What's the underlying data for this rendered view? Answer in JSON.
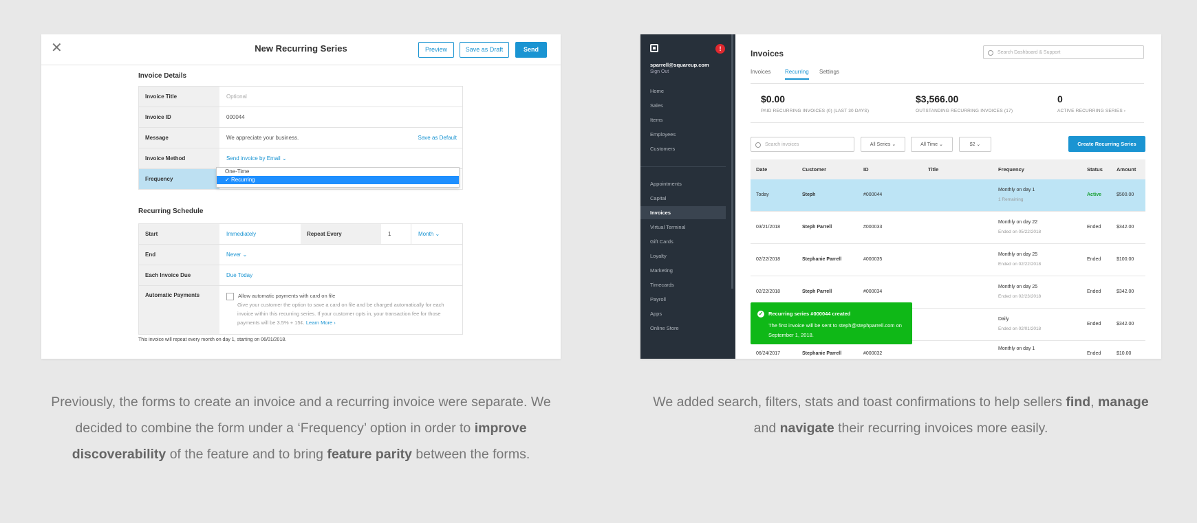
{
  "left": {
    "title": "New Recurring Series",
    "buttons": {
      "preview": "Preview",
      "save_draft": "Save as Draft",
      "send": "Send"
    },
    "invoice_details": {
      "heading": "Invoice Details",
      "invoice_title": {
        "label": "Invoice Title",
        "placeholder": "Optional"
      },
      "invoice_id": {
        "label": "Invoice ID",
        "value": "000044"
      },
      "message": {
        "label": "Message",
        "value": "We appreciate your business.",
        "action": "Save as Default"
      },
      "invoice_method": {
        "label": "Invoice Method",
        "value": "Send invoice by Email"
      },
      "frequency": {
        "label": "Frequency",
        "options": [
          "One-Time",
          "Recurring"
        ],
        "selected": "Recurring"
      }
    },
    "schedule": {
      "heading": "Recurring Schedule",
      "start": {
        "label": "Start",
        "value": "Immediately"
      },
      "repeat_every": {
        "label": "Repeat Every",
        "value": "1",
        "unit": "Month"
      },
      "end": {
        "label": "End",
        "value": "Never"
      },
      "due": {
        "label": "Each Invoice Due",
        "value": "Due Today"
      },
      "autopay": {
        "label": "Automatic Payments",
        "checkbox_label": "Allow automatic payments with card on file",
        "description": "Give your customer the option to save a card on file and be charged automatically for each invoice within this recurring series. If your customer opts in, your transaction fee for those payments will be 3.5% + 15¢.",
        "learn_more": "Learn More"
      }
    },
    "footnote": "This invoice will repeat every month on day 1, starting on 06/01/2018."
  },
  "right": {
    "sidebar": {
      "alert_count": "!",
      "user_email": "sparrell@squareup.com",
      "sign_out": "Sign Out",
      "items_top": [
        "Home",
        "Sales",
        "Items",
        "Employees",
        "Customers"
      ],
      "items_bottom": [
        "Appointments",
        "Capital",
        "Invoices",
        "Virtual Terminal",
        "Gift Cards",
        "Loyalty",
        "Marketing",
        "Timecards",
        "Payroll",
        "Apps",
        "Online Store"
      ],
      "active": "Invoices"
    },
    "title": "Invoices",
    "search_placeholder": "Search Dashboard & Support",
    "tabs": [
      "Invoices",
      "Recurring",
      "Settings"
    ],
    "active_tab": "Recurring",
    "stats": [
      {
        "value": "$0.00",
        "label": "PAID RECURRING INVOICES (0) (LAST 30 DAYS)"
      },
      {
        "value": "$3,566.00",
        "label": "OUTSTANDING RECURRING INVOICES (17)"
      },
      {
        "value": "0",
        "label": "ACTIVE RECURRING SERIES ›"
      }
    ],
    "filters": {
      "search_placeholder": "Search invoices",
      "series": "All Series",
      "time": "All Time",
      "amount": "$2",
      "create_button": "Create Recurring Series"
    },
    "columns": [
      "Date",
      "Customer",
      "ID",
      "Title",
      "Frequency",
      "Status",
      "Amount"
    ],
    "rows": [
      {
        "date": "Today",
        "customer": "Steph",
        "id": "#000044",
        "frequency": "Monthly on day 1",
        "sub": "1 Remaining",
        "status": "Active",
        "amount": "$500.00"
      },
      {
        "date": "03/21/2018",
        "customer": "Steph Parrell",
        "id": "#000033",
        "frequency": "Monthly on day 22",
        "sub": "Ended on 05/22/2018",
        "status": "Ended",
        "amount": "$342.00"
      },
      {
        "date": "02/22/2018",
        "customer": "Stephanie Parrell",
        "id": "#000035",
        "frequency": "Monthly on day 25",
        "sub": "Ended on 02/22/2018",
        "status": "Ended",
        "amount": "$100.00"
      },
      {
        "date": "02/22/2018",
        "customer": "Steph Parrell",
        "id": "#000034",
        "frequency": "Monthly on day 25",
        "sub": "Ended on 02/23/2018",
        "status": "Ended",
        "amount": "$342.00"
      },
      {
        "date": "",
        "customer": "",
        "id": "",
        "frequency": "Daily",
        "sub": "Ended on 02/01/2018",
        "status": "Ended",
        "amount": "$342.00"
      },
      {
        "date": "06/24/2017",
        "customer": "Stephanie Parrell",
        "id": "#000032",
        "frequency": "Monthly on day 1",
        "sub": "",
        "status": "Ended",
        "amount": "$10.00"
      }
    ],
    "toast": {
      "title": "Recurring series #000044 created",
      "body": "The first invoice will be sent to steph@stephparrell.com on September 1, 2018."
    }
  },
  "captions": {
    "left": {
      "p1": "Previously, the forms to create an invoice and a recurring invoice were separate. We decided to combine the form under a ‘Frequency’ option in order to ",
      "b1": "improve discoverability",
      "p2": " of the feature and to bring ",
      "b2": "feature parity",
      "p3": " between the forms."
    },
    "right": {
      "p1": "We added search, filters, stats and toast confirmations to help sellers ",
      "b1": "find",
      "p2": ", ",
      "b2": "manage",
      "p3": " and ",
      "b3": "navigate",
      "p4": " their recurring invoices more easily."
    }
  },
  "colors": {
    "accent": "#1a94d2",
    "toast": "#0fb817",
    "sidebar": "#27303a",
    "highlight": "#bde4f5",
    "background": "#e8e8e8"
  }
}
